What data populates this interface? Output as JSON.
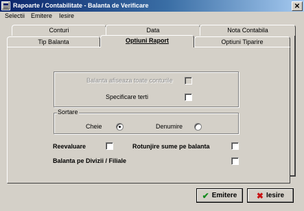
{
  "window": {
    "title": "Rapoarte / Contabilitate - Balanta de Verificare",
    "close_glyph": "✕"
  },
  "menu": [
    "Selectii",
    "Emitere",
    "Iesire"
  ],
  "tabs_back": [
    "Conturi",
    "Data",
    "Nota Contabila"
  ],
  "tabs_front": [
    "Tip Balanta",
    "Optiuni Raport",
    "Optiuni Tiparire"
  ],
  "active_tab": "Optiuni Raport",
  "options": {
    "show_all_accounts": {
      "label": "Balanta afiseaza toate conturile",
      "checked": false,
      "enabled": false
    },
    "specify_third_parties": {
      "label": "Specificare terti",
      "checked": false
    }
  },
  "sort": {
    "legend": "Sortare",
    "key_label": "Cheie",
    "key_selected": true,
    "name_label": "Denumire",
    "name_selected": false
  },
  "reevaluation": {
    "label": "Reevaluare",
    "checked": false
  },
  "rounding": {
    "label": "Rotunjire sume pe balanta",
    "checked": false
  },
  "division_balance": {
    "label": "Balanta pe Divizii / Filiale",
    "checked": false
  },
  "buttons": {
    "emit": {
      "label": "Emitere",
      "icon": "checkmark-icon",
      "glyph": "✔"
    },
    "exit": {
      "label": "Iesire",
      "icon": "x-icon",
      "glyph": "✖"
    }
  }
}
